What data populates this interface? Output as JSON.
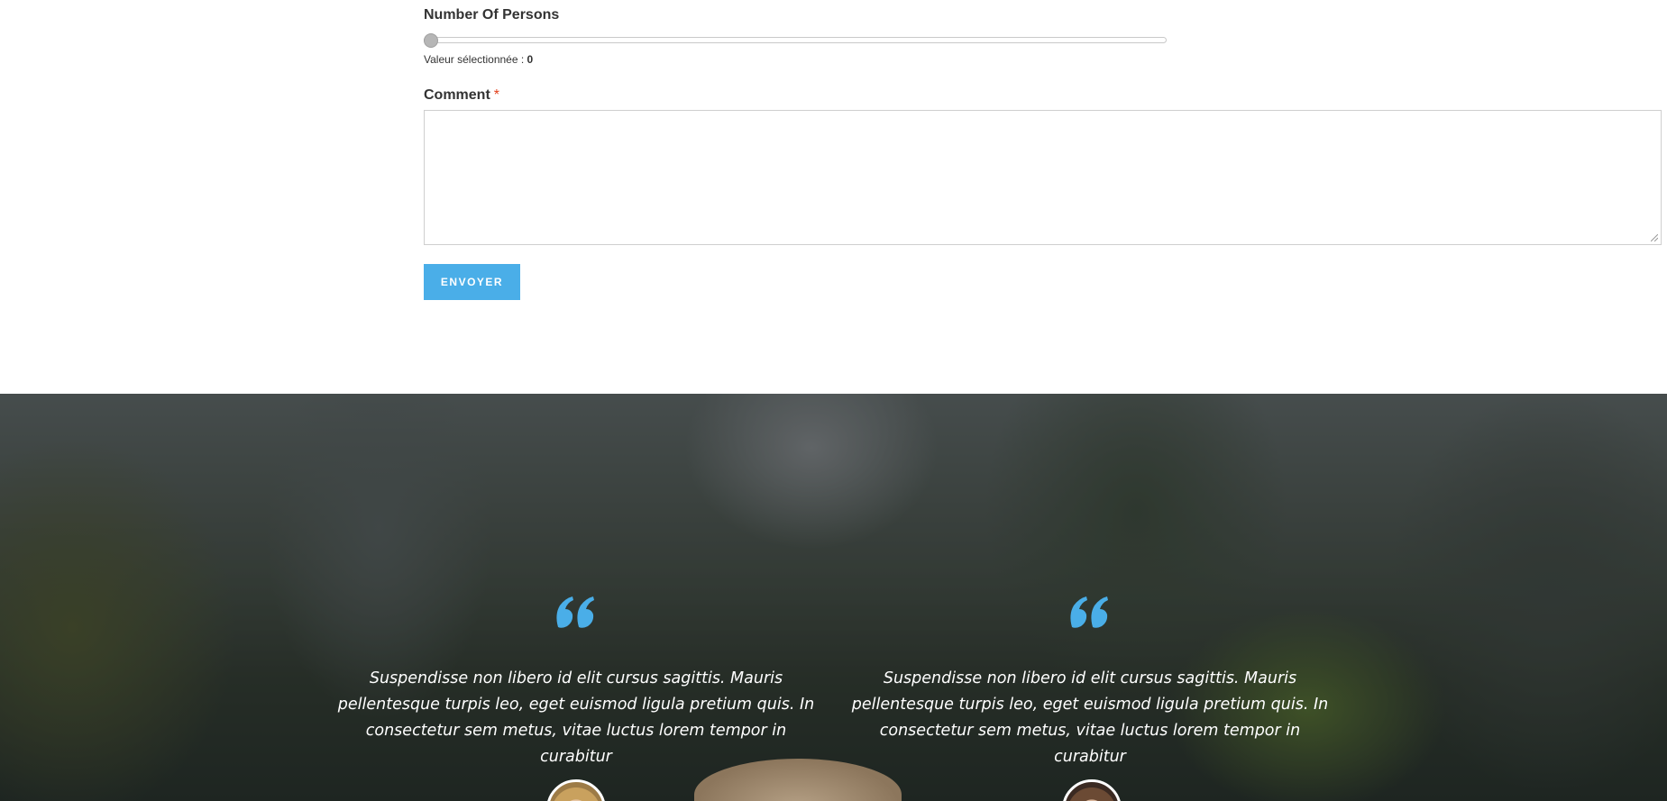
{
  "form": {
    "persons_label": "Number Of Persons",
    "persons_value": 0,
    "selected_value_label": "Valeur sélectionnée : ",
    "selected_value": "0",
    "comment_label": "Comment",
    "required_marker": "*",
    "comment_value": "",
    "submit_label": "ENVOYER"
  },
  "testimonials": {
    "items": [
      {
        "quote": "Suspendisse non libero id elit cursus sagittis. Mauris pellentesque turpis leo, eget euismod ligula pretium quis. In consectetur sem metus, vitae luctus lorem tempor in curabitur"
      },
      {
        "quote": "Suspendisse non libero id elit cursus sagittis. Mauris pellentesque turpis leo, eget euismod ligula pretium quis. In consectetur sem metus, vitae luctus lorem tempor in curabitur"
      }
    ]
  },
  "colors": {
    "accent": "#4aaee8",
    "quote_icon": "#4aaee8",
    "required": "#e2401c",
    "label_text": "#333333"
  },
  "icons": {
    "quote": "quote-icon",
    "slider_thumb": "slider-handle"
  }
}
